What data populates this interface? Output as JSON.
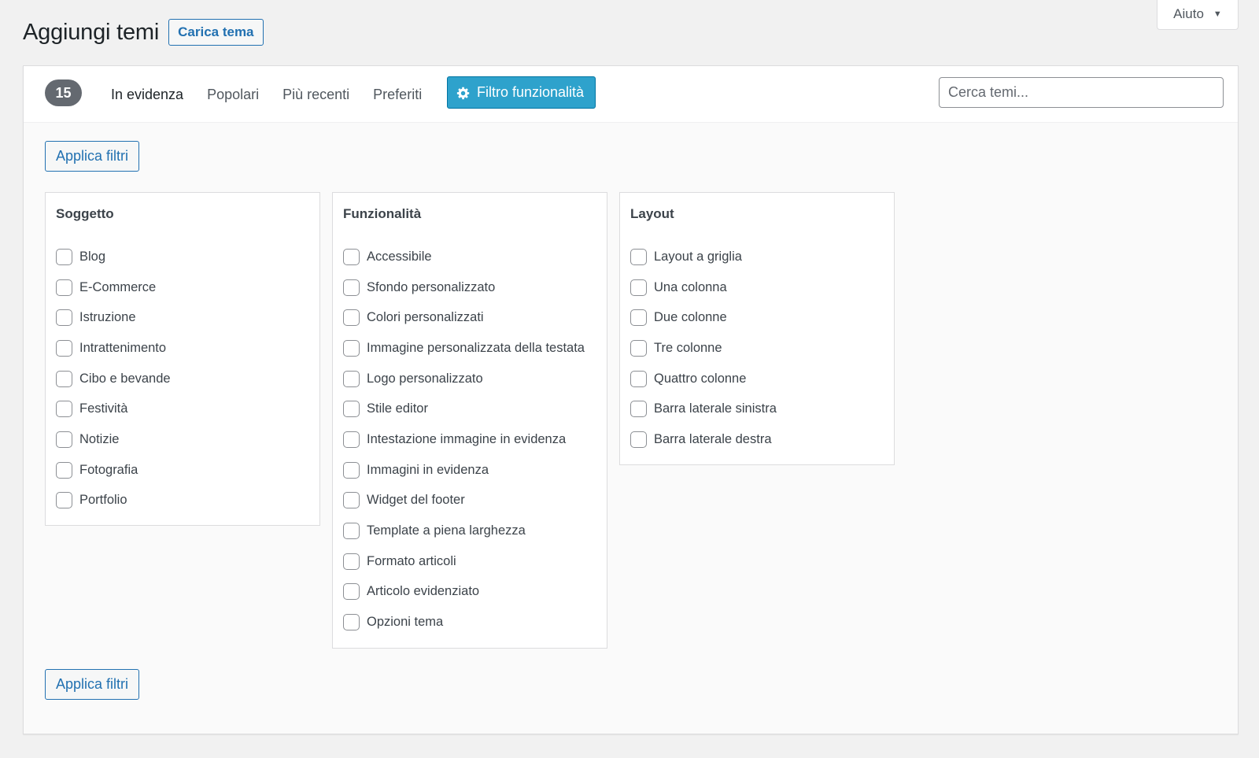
{
  "help_tab": {
    "label": "Aiuto",
    "icon": "caret-down-icon"
  },
  "header": {
    "title": "Aggiungi temi",
    "upload_button": "Carica tema"
  },
  "filter_bar": {
    "count": "15",
    "links": [
      {
        "label": "In evidenza",
        "current": true
      },
      {
        "label": "Popolari",
        "current": false
      },
      {
        "label": "Più recenti",
        "current": false
      },
      {
        "label": "Preferiti",
        "current": false
      }
    ],
    "feature_filter_button": {
      "label": "Filtro funzionalità",
      "icon": "gear-icon",
      "active": true
    },
    "search": {
      "placeholder": "Cerca temi...",
      "value": ""
    }
  },
  "apply_button_label": "Applica filtri",
  "groups": [
    {
      "title": "Soggetto",
      "items": [
        {
          "label": "Blog",
          "checked": false
        },
        {
          "label": "E-Commerce",
          "checked": false
        },
        {
          "label": "Istruzione",
          "checked": false
        },
        {
          "label": "Intrattenimento",
          "checked": false
        },
        {
          "label": "Cibo e bevande",
          "checked": false
        },
        {
          "label": "Festività",
          "checked": false
        },
        {
          "label": "Notizie",
          "checked": false
        },
        {
          "label": "Fotografia",
          "checked": false
        },
        {
          "label": "Portfolio",
          "checked": false
        }
      ]
    },
    {
      "title": "Funzionalità",
      "items": [
        {
          "label": "Accessibile",
          "checked": false
        },
        {
          "label": "Sfondo personalizzato",
          "checked": false
        },
        {
          "label": "Colori personalizzati",
          "checked": false
        },
        {
          "label": "Immagine personalizzata della testata",
          "checked": false
        },
        {
          "label": "Logo personalizzato",
          "checked": false
        },
        {
          "label": "Stile editor",
          "checked": false
        },
        {
          "label": "Intestazione immagine in evidenza",
          "checked": false
        },
        {
          "label": "Immagini in evidenza",
          "checked": false
        },
        {
          "label": "Widget del footer",
          "checked": false
        },
        {
          "label": "Template a piena larghezza",
          "checked": false
        },
        {
          "label": "Formato articoli",
          "checked": false
        },
        {
          "label": "Articolo evidenziato",
          "checked": false
        },
        {
          "label": "Opzioni tema",
          "checked": false
        }
      ]
    },
    {
      "title": "Layout",
      "items": [
        {
          "label": "Layout a griglia",
          "checked": false
        },
        {
          "label": "Una colonna",
          "checked": false
        },
        {
          "label": "Due colonne",
          "checked": false
        },
        {
          "label": "Tre colonne",
          "checked": false
        },
        {
          "label": "Quattro colonne",
          "checked": false
        },
        {
          "label": "Barra laterale sinistra",
          "checked": false
        },
        {
          "label": "Barra laterale destra",
          "checked": false
        }
      ]
    }
  ],
  "colors": {
    "accent": "#2271b1",
    "feature_button_bg": "#2ea2cc",
    "badge_bg": "#646970"
  }
}
